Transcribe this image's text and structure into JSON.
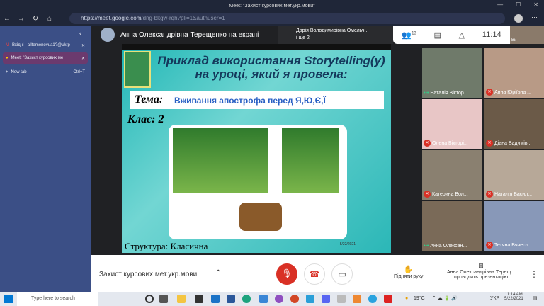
{
  "window": {
    "title": "Meet: \"Захист курсових мет.укр.мови\""
  },
  "browser": {
    "url_host": "https://meet.google.com",
    "url_path": "/dng-bkgw-rqh?pli=1&authuser=1"
  },
  "sidebar": {
    "tabs": [
      {
        "label": "Вхідні - alltemenovua1?@ukrp"
      },
      {
        "label": "Meet: \"Захист курсових ме"
      }
    ],
    "new_tab": "New tab",
    "new_tab_shortcut": "Ctrl+T"
  },
  "meet": {
    "presenter_title": "Анна Олександрівна Терещенко на екрані",
    "speaker": {
      "name": "Дарія Володимирівна Омельч...",
      "more": "і ще 2"
    },
    "participants_count": "13",
    "time": "11:14",
    "self_label": "Ви",
    "participants": [
      {
        "name": "Наталія Віктор..."
      },
      {
        "name": "Анна Юріївна ..."
      },
      {
        "name": "Олена Вікторі..."
      },
      {
        "name": "Діана Вадимів..."
      },
      {
        "name": "Катерина Вол..."
      },
      {
        "name": "Наталія Васил..."
      },
      {
        "name": "Анна Олексан..."
      },
      {
        "name": "Тетяна Вячесл..."
      }
    ],
    "meeting_name": "Захист курсових мет.укр.мови",
    "raise_hand": "Підняти руку",
    "presenting_name": "Анна Олександрівна Терещ...",
    "presenting_status": "проводить презентацію"
  },
  "slide": {
    "title": "Приклад використання Storytelling(у) на уроці, який я провела:",
    "theme_label": "Тема:",
    "theme": "Вживання апострофа перед Я,Ю,Є,Ї",
    "class": "Клас: 2",
    "structure": "Структура: Класична",
    "date": "5/22/2021"
  },
  "taskbar": {
    "search": "Type here to search",
    "weather": "19°C",
    "lang": "УКР",
    "time": "11:14 AM",
    "date": "5/22/2021"
  }
}
